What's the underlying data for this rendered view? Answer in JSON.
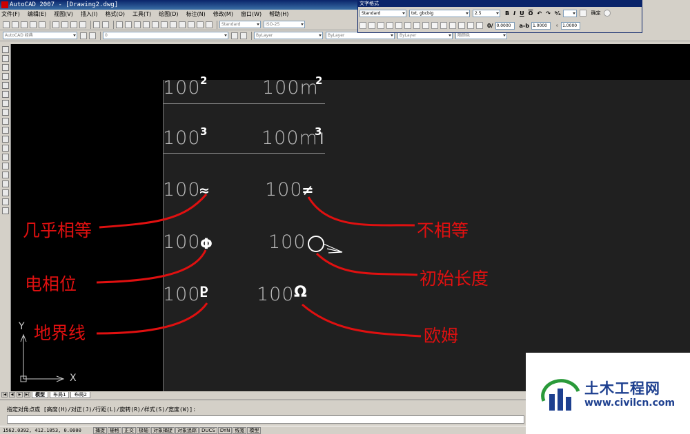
{
  "window": {
    "title": "AutoCAD 2007 - [Drawing2.dwg]"
  },
  "menu": [
    "文件(F)",
    "编辑(E)",
    "视图(V)",
    "插入(I)",
    "格式(O)",
    "工具(T)",
    "绘图(D)",
    "标注(N)",
    "修改(M)",
    "窗口(W)",
    "帮助(H)"
  ],
  "toolbar2": {
    "workspace": "AutoCAD 经典",
    "layer": "0",
    "style1": "Standard",
    "style2": "ISO-25"
  },
  "toolbar3": {
    "color": "ByLayer",
    "linetype": "ByLayer",
    "lineweight": "ByLayer",
    "plotstyle": "随颜色"
  },
  "text_format": {
    "title": "文字格式",
    "style": "Standard",
    "font": "txt, gbcbig",
    "height": "2.5",
    "ok": "确定",
    "oblique": "0.0000",
    "tracking": "1.0000",
    "width": "1.0000"
  },
  "drawing": {
    "items": [
      {
        "base": "100",
        "sym": "2"
      },
      {
        "base": "100m",
        "sym": "2"
      },
      {
        "base": "100",
        "sym": "3"
      },
      {
        "base": "100m",
        "sym": "3"
      },
      {
        "base": "100",
        "sym": "≈"
      },
      {
        "base": "100",
        "sym": "≠"
      },
      {
        "base": "100",
        "sym": "Φ"
      },
      {
        "base": "100",
        "sym": ""
      },
      {
        "base": "100",
        "sym": "Ⴒ"
      },
      {
        "base": "100",
        "sym": "Ω"
      }
    ],
    "cursor": "I"
  },
  "annotations": [
    "几乎相等",
    "不相等",
    "电相位",
    "初始长度",
    "地界线",
    "欧姆"
  ],
  "ucs": {
    "y": "Y",
    "x": "X"
  },
  "tabs": [
    "模型",
    "布局1",
    "布局2"
  ],
  "command": {
    "prompt": "指定对角点或 [高度(H)/对正(J)/行距(L)/旋转(R)/样式(S)/宽度(W)]:"
  },
  "status": {
    "coords": "1562.0392, 412.1053, 0.0000",
    "buttons": [
      "捕捉",
      "栅格",
      "正交",
      "极轴",
      "对象捕捉",
      "对象追踪",
      "DUCS",
      "DYN",
      "线宽",
      "模型"
    ]
  },
  "watermark": {
    "brand": "土木工程网",
    "url": "www.civilcn.com"
  },
  "colors": {
    "annotation": "#e01010",
    "canvas": "#000000",
    "mtext_bg": "#202020"
  }
}
